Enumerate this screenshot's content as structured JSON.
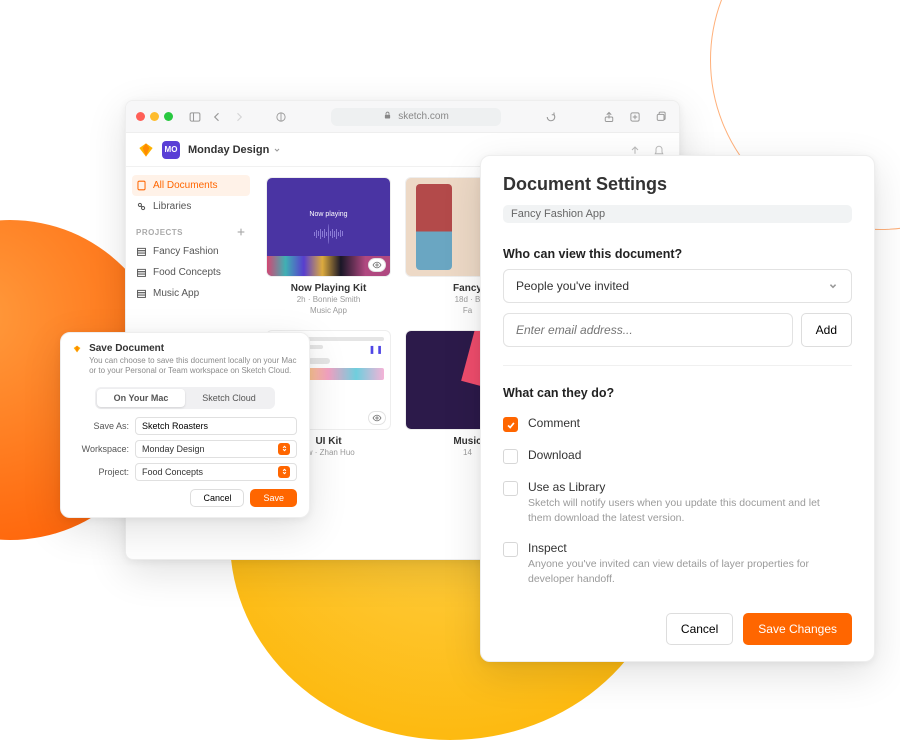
{
  "browser": {
    "url": "sketch.com"
  },
  "workspace": {
    "badge": "MO",
    "name": "Monday Design"
  },
  "sidebar": {
    "items": [
      {
        "label": "All Documents"
      },
      {
        "label": "Libraries"
      }
    ],
    "projects_heading": "PROJECTS",
    "projects": [
      {
        "label": "Fancy Fashion"
      },
      {
        "label": "Food Concepts"
      },
      {
        "label": "Music App"
      }
    ]
  },
  "cards": [
    {
      "title": "Now Playing Kit",
      "meta1": "2h · Bonnie Smith",
      "meta2": "Music App"
    },
    {
      "title": "Fancy",
      "meta1": "18d · B",
      "meta2": "Fa"
    },
    {
      "title": ""
    },
    {
      "title": "UI Kit",
      "meta1": "1w · Zhan Huo",
      "meta2": ""
    },
    {
      "title": "Music",
      "meta1": "14",
      "meta2": ""
    },
    {
      "title": ""
    }
  ],
  "sheet": {
    "title": "Save Document",
    "desc": "You can choose to save this document locally on your Mac or to your Personal or Team workspace on Sketch Cloud.",
    "seg_local": "On Your Mac",
    "seg_cloud": "Sketch Cloud",
    "save_as_label": "Save As:",
    "save_as_value": "Sketch Roasters",
    "workspace_label": "Workspace:",
    "workspace_value": "Monday Design",
    "project_label": "Project:",
    "project_value": "Food Concepts",
    "cancel": "Cancel",
    "save": "Save"
  },
  "panel": {
    "title": "Document Settings",
    "doc": "Fancy Fashion App",
    "view_heading": "Who can view this document?",
    "view_value": "People you've invited",
    "email_placeholder": "Enter email address...",
    "add": "Add",
    "perm_heading": "What can they do?",
    "perms": [
      {
        "label": "Comment",
        "checked": true,
        "hint": ""
      },
      {
        "label": "Download",
        "checked": false,
        "hint": ""
      },
      {
        "label": "Use as Library",
        "checked": false,
        "hint": "Sketch will notify users when you update this document and let them download the latest version."
      },
      {
        "label": "Inspect",
        "checked": false,
        "hint": "Anyone you've invited can view details of layer properties for developer handoff."
      }
    ],
    "cancel": "Cancel",
    "save": "Save Changes"
  }
}
